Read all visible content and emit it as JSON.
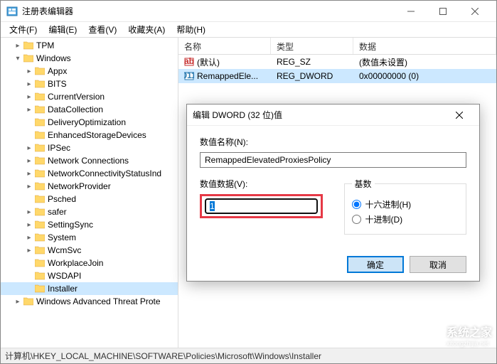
{
  "window": {
    "title": "注册表编辑器"
  },
  "menu": {
    "file": "文件(F)",
    "edit": "编辑(E)",
    "view": "查看(V)",
    "favorites": "收藏夹(A)",
    "help": "帮助(H)"
  },
  "tree": {
    "items": [
      {
        "indent": 1,
        "exp": "▸",
        "label": "TPM"
      },
      {
        "indent": 1,
        "exp": "▾",
        "label": "Windows"
      },
      {
        "indent": 2,
        "exp": "▸",
        "label": "Appx"
      },
      {
        "indent": 2,
        "exp": "▸",
        "label": "BITS"
      },
      {
        "indent": 2,
        "exp": "▸",
        "label": "CurrentVersion"
      },
      {
        "indent": 2,
        "exp": "▸",
        "label": "DataCollection"
      },
      {
        "indent": 2,
        "exp": "",
        "label": "DeliveryOptimization"
      },
      {
        "indent": 2,
        "exp": "",
        "label": "EnhancedStorageDevices"
      },
      {
        "indent": 2,
        "exp": "▸",
        "label": "IPSec"
      },
      {
        "indent": 2,
        "exp": "▸",
        "label": "Network Connections"
      },
      {
        "indent": 2,
        "exp": "▸",
        "label": "NetworkConnectivityStatusInd"
      },
      {
        "indent": 2,
        "exp": "▸",
        "label": "NetworkProvider"
      },
      {
        "indent": 2,
        "exp": "",
        "label": "Psched"
      },
      {
        "indent": 2,
        "exp": "▸",
        "label": "safer"
      },
      {
        "indent": 2,
        "exp": "▸",
        "label": "SettingSync"
      },
      {
        "indent": 2,
        "exp": "▸",
        "label": "System"
      },
      {
        "indent": 2,
        "exp": "▸",
        "label": "WcmSvc"
      },
      {
        "indent": 2,
        "exp": "",
        "label": "WorkplaceJoin"
      },
      {
        "indent": 2,
        "exp": "",
        "label": "WSDAPI"
      },
      {
        "indent": 2,
        "exp": "",
        "label": "Installer",
        "selected": true
      },
      {
        "indent": 1,
        "exp": "▸",
        "label": "Windows Advanced Threat Prote"
      }
    ]
  },
  "list": {
    "headers": {
      "name": "名称",
      "type": "类型",
      "data": "数据"
    },
    "rows": [
      {
        "icon": "string",
        "name": "(默认)",
        "type": "REG_SZ",
        "data": "(数值未设置)",
        "selected": false
      },
      {
        "icon": "binary",
        "name": "RemappedEle...",
        "type": "REG_DWORD",
        "data": "0x00000000 (0)",
        "selected": true
      }
    ]
  },
  "statusbar": {
    "path": "计算机\\HKEY_LOCAL_MACHINE\\SOFTWARE\\Policies\\Microsoft\\Windows\\Installer"
  },
  "watermark": {
    "text": "系统之家",
    "url": "xitongzhijia.net"
  },
  "dialog": {
    "title": "编辑 DWORD (32 位)值",
    "name_label": "数值名称(N):",
    "name_value": "RemappedElevatedProxiesPolicy",
    "data_label": "数值数据(V):",
    "data_value": "1",
    "base_label": "基数",
    "radix_hex": "十六进制(H)",
    "radix_dec": "十进制(D)",
    "ok": "确定",
    "cancel": "取消"
  }
}
